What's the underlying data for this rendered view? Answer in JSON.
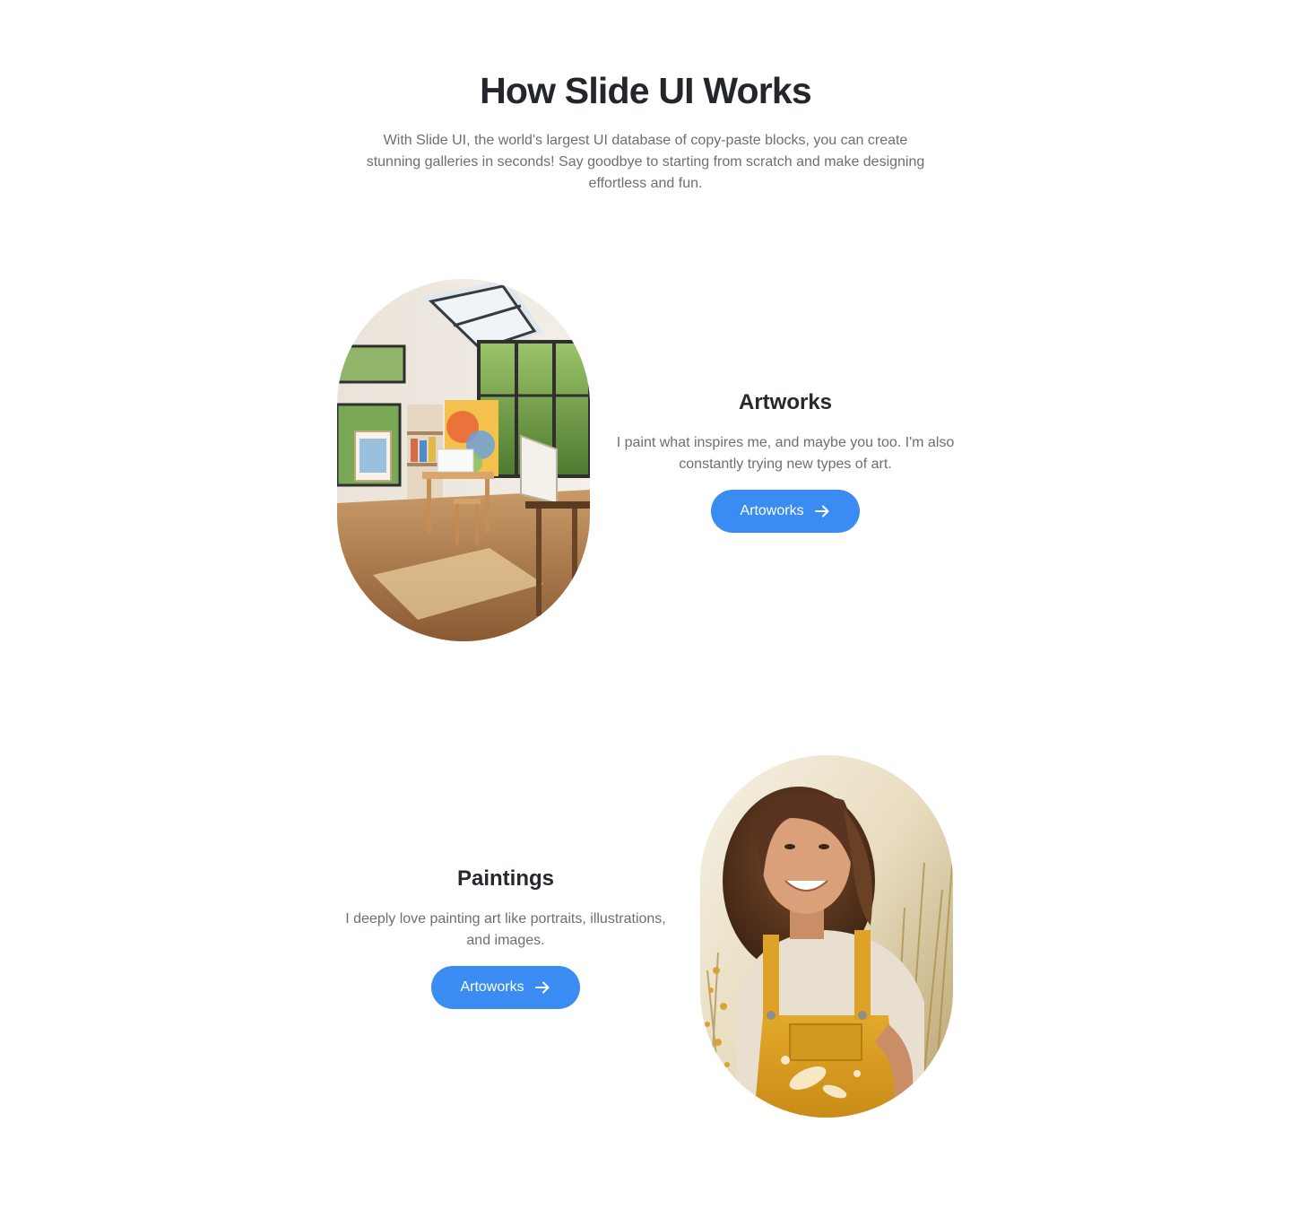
{
  "section": {
    "title": "How Slide UI Works",
    "intro": "With Slide UI, the world's largest UI database of copy-paste blocks, you can create stunning galleries in seconds! Say goodbye to starting from scratch and make designing effortless and fun."
  },
  "features": [
    {
      "title": "Artworks",
      "description": "I paint what inspires me, and maybe you too. I'm also constantly trying new types of art.",
      "button_label": "Artoworks",
      "image": "art-studio-photo"
    },
    {
      "title": "Paintings",
      "description": "I deeply love painting art like portraits, illustrations, and images.",
      "button_label": "Artoworks",
      "image": "smiling-artist-portrait-photo"
    }
  ],
  "colors": {
    "accent": "#3b8cf2",
    "heading": "#23272b",
    "body_text": "#6b6f75"
  },
  "icons": {
    "button_icon": "arrow-right-icon"
  }
}
